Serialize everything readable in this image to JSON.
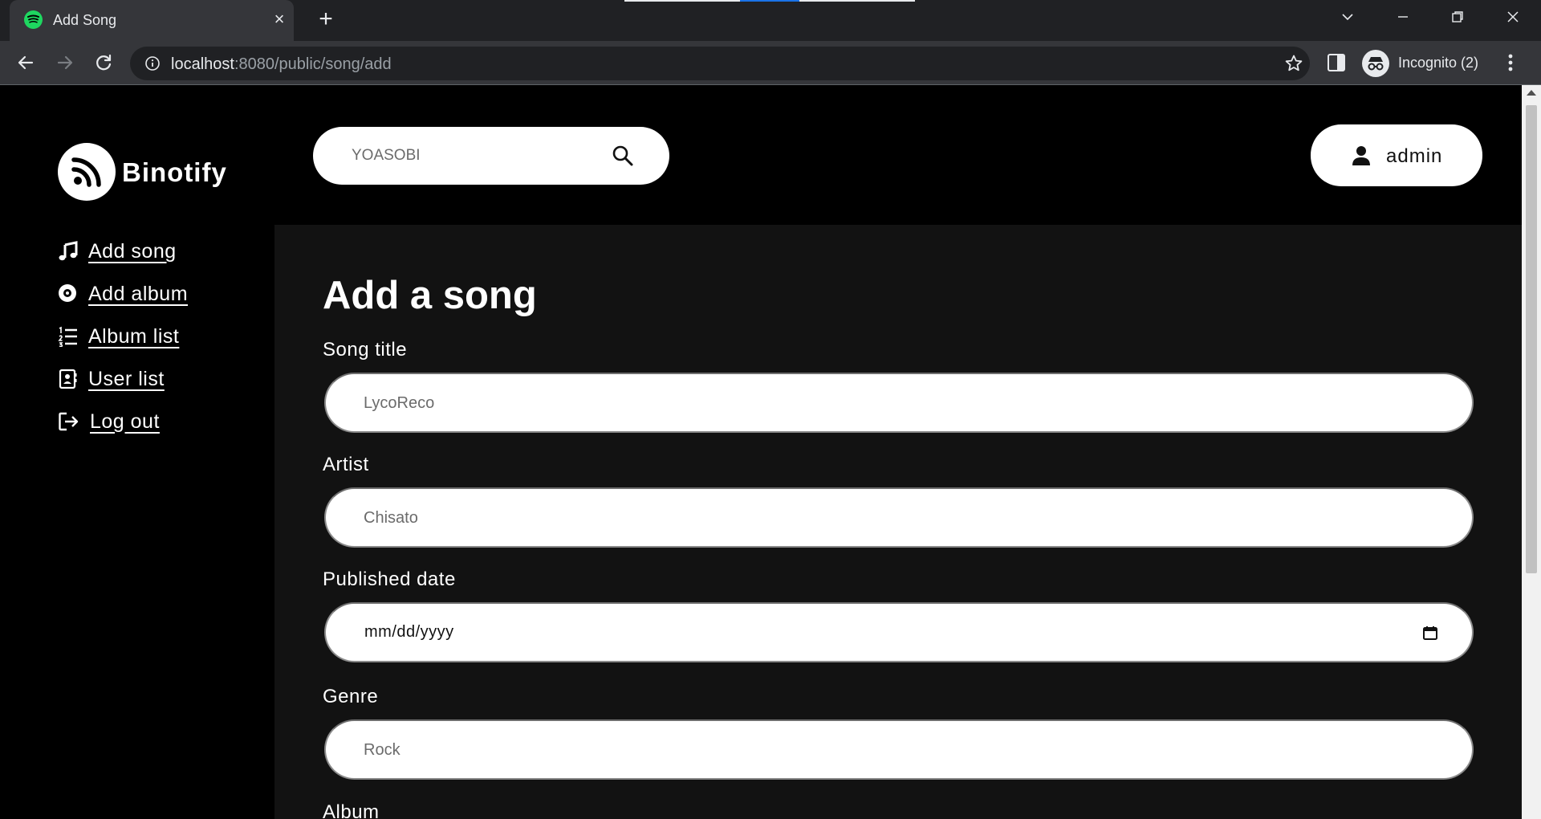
{
  "browser": {
    "tab_title": "Add Song",
    "url_host": "localhost",
    "url_rest": ":8080/public/song/add",
    "profile_label": "Incognito (2)"
  },
  "brand": {
    "name": "Binotify"
  },
  "sidebar": {
    "items": [
      {
        "label": "Add song",
        "icon": "music-note-icon"
      },
      {
        "label": "Add album",
        "icon": "disc-icon"
      },
      {
        "label": "Album list",
        "icon": "numbered-list-icon"
      },
      {
        "label": "User list",
        "icon": "contact-card-icon"
      },
      {
        "label": "Log out",
        "icon": "logout-icon"
      }
    ]
  },
  "header": {
    "search_placeholder": "YOASOBI",
    "username": "admin"
  },
  "form": {
    "title": "Add a song",
    "song_title_label": "Song title",
    "song_title_placeholder": "LycoReco",
    "artist_label": "Artist",
    "artist_placeholder": "Chisato",
    "date_label": "Published date",
    "date_placeholder": "mm/dd/yyyy",
    "genre_label": "Genre",
    "genre_placeholder": "Rock",
    "album_label": "Album"
  },
  "colors": {
    "page_background": "#000000",
    "panel_background": "#121212",
    "spotify_green": "#1ed760"
  }
}
